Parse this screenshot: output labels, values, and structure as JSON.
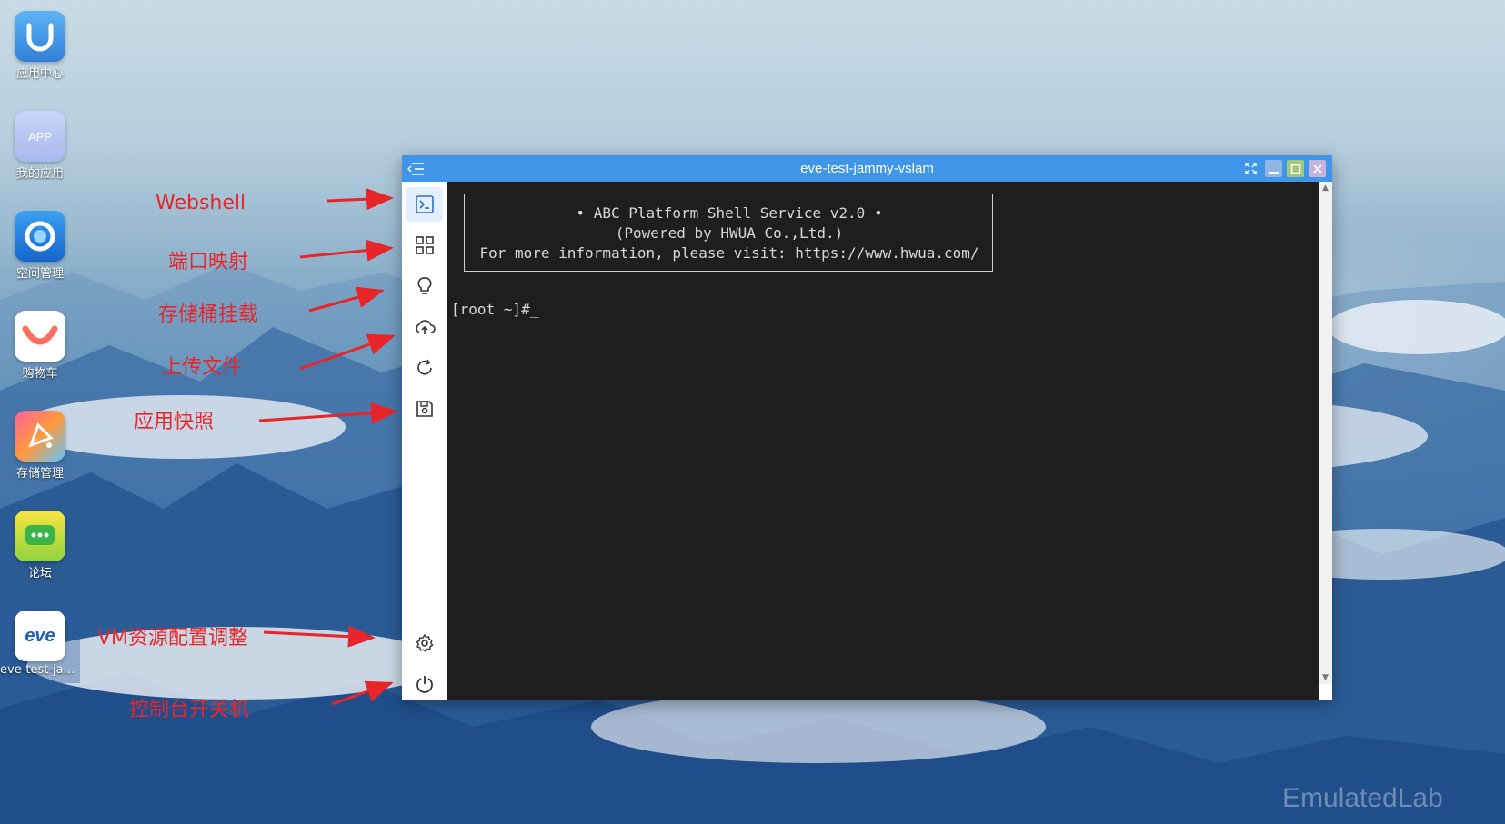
{
  "desktop": {
    "apps": [
      {
        "label": "应用中心",
        "icon": "app-center-icon"
      },
      {
        "label": "我的应用",
        "icon": "my-apps-icon",
        "badge": "APP"
      },
      {
        "label": "空间管理",
        "icon": "space-management-icon"
      },
      {
        "label": "购物车",
        "icon": "shopping-cart-icon"
      },
      {
        "label": "存储管理",
        "icon": "storage-management-icon"
      },
      {
        "label": "论坛",
        "icon": "forum-icon"
      },
      {
        "label": "eve-test-jam...",
        "icon": "eve-logo-icon",
        "logo_text": "eve"
      }
    ]
  },
  "annotations": {
    "webshell": "Webshell",
    "port_mapping": "端口映射",
    "bucket_mount": "存储桶挂载",
    "upload_file": "上传文件",
    "app_snapshot": "应用快照",
    "vm_resource": "VM资源配置调整",
    "power": "控制台开关机"
  },
  "window": {
    "title": "eve-test-jammy-vslam",
    "titlebar_color": "#3f95e8",
    "sidebar_tools": [
      "terminal-icon",
      "grid-icon",
      "lightbulb-icon",
      "cloud-upload-icon",
      "refresh-icon",
      "save-icon",
      "gear-icon",
      "power-icon"
    ],
    "active_tool": "terminal-icon"
  },
  "terminal": {
    "banner_line1": "• ABC Platform Shell Service v2.0 •",
    "banner_line2": "(Powered by HWUA Co.,Ltd.)",
    "banner_line3": "For more information, please visit: https://www.hwua.com/",
    "prompt": "[root ~]#_"
  },
  "colors": {
    "annotation": "#e8262a",
    "terminal_bg": "#1e1e1e"
  },
  "watermark": "EmulatedLab"
}
